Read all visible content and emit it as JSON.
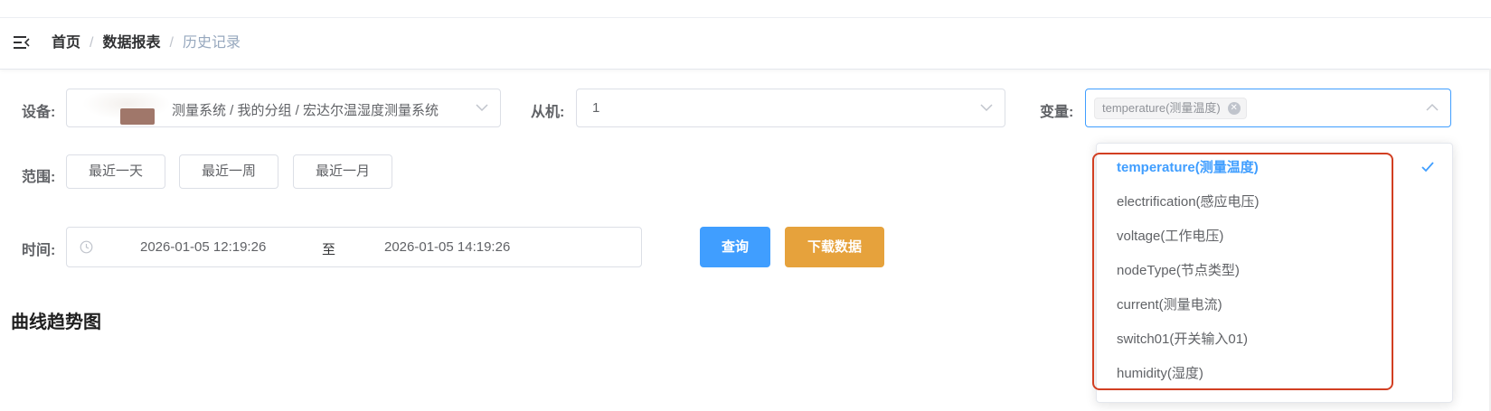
{
  "breadcrumb": {
    "items": [
      "首页",
      "数据报表"
    ],
    "current": "历史记录",
    "separator": "/"
  },
  "filters": {
    "device_label": "设备:",
    "device_value": "测量系统 / 我的分组 / 宏达尔温湿度测量系统",
    "slave_label": "从机:",
    "slave_value": "1",
    "variable_label": "变量:",
    "variable_tag": "temperature(测量温度)",
    "range_label": "范围:",
    "range_buttons": [
      "最近一天",
      "最近一周",
      "最近一月"
    ],
    "time_label": "时间:",
    "time_start": "2026-01-05 12:19:26",
    "time_separator": "至",
    "time_end": "2026-01-05 14:19:26",
    "query_button": "查询",
    "download_button": "下载数据"
  },
  "chart_section": {
    "title": "曲线趋势图"
  },
  "variable_dropdown": {
    "options": [
      "temperature(测量温度)",
      "electrification(感应电压)",
      "voltage(工作电压)",
      "nodeType(节点类型)",
      "current(测量电流)",
      "switch01(开关输入01)",
      "humidity(湿度)"
    ],
    "selected_index": 0
  },
  "colors": {
    "primary": "#409eff",
    "warning": "#e6a23c",
    "highlight_border": "#d23f22"
  },
  "icons": {
    "menu": "menu-fold-icon",
    "chevron": "chevron-down-icon",
    "clock": "clock-icon",
    "check": "check-icon",
    "tag_close": "circle-close-icon"
  }
}
